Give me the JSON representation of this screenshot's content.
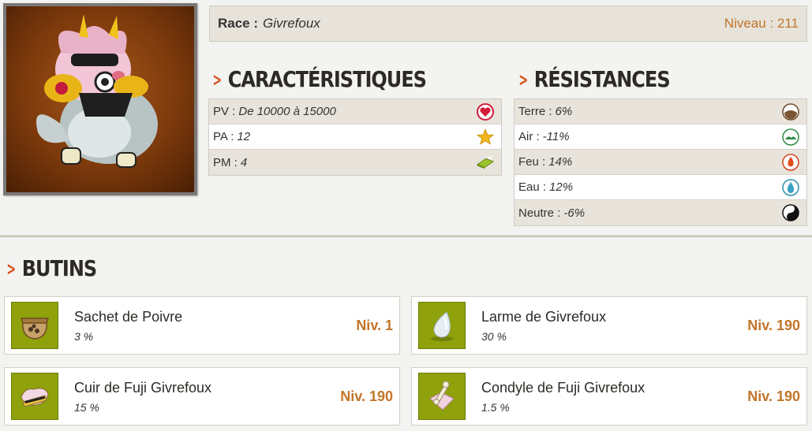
{
  "race": {
    "label": "Race :",
    "value": "Givrefoux",
    "level": "Niveau : 211"
  },
  "characteristics": {
    "title": "CARACTÉRISTIQUES",
    "rows": [
      {
        "key": "PV :",
        "value": "De 10000 à 15000",
        "icon": "heart-icon"
      },
      {
        "key": "PA :",
        "value": "12",
        "icon": "star-icon"
      },
      {
        "key": "PM :",
        "value": "4",
        "icon": "movement-icon"
      }
    ]
  },
  "resistances": {
    "title": "RÉSISTANCES",
    "rows": [
      {
        "key": "Terre :",
        "value": "6%",
        "icon": "earth-icon"
      },
      {
        "key": "Air :",
        "value": "-11%",
        "icon": "air-icon"
      },
      {
        "key": "Feu :",
        "value": "14%",
        "icon": "fire-icon"
      },
      {
        "key": "Eau :",
        "value": "12%",
        "icon": "water-icon"
      },
      {
        "key": "Neutre :",
        "value": "-6%",
        "icon": "neutral-icon"
      }
    ]
  },
  "loot": {
    "title": "BUTINS",
    "items": [
      {
        "name": "Sachet de Poivre",
        "pct": "3 %",
        "level": "Niv. 1",
        "icon": "pepper-bag-icon"
      },
      {
        "name": "Larme de Givrefoux",
        "pct": "30 %",
        "level": "Niv. 190",
        "icon": "tear-icon"
      },
      {
        "name": "Cuir de Fuji Givrefoux",
        "pct": "15 %",
        "level": "Niv. 190",
        "icon": "leather-icon"
      },
      {
        "name": "Condyle de Fuji Givrefoux",
        "pct": "1.5 %",
        "level": "Niv. 190",
        "icon": "condyle-icon"
      }
    ]
  },
  "colors": {
    "accent": "#d8501b",
    "level": "#c2752a",
    "thumb_bg": "#8fa10b"
  }
}
